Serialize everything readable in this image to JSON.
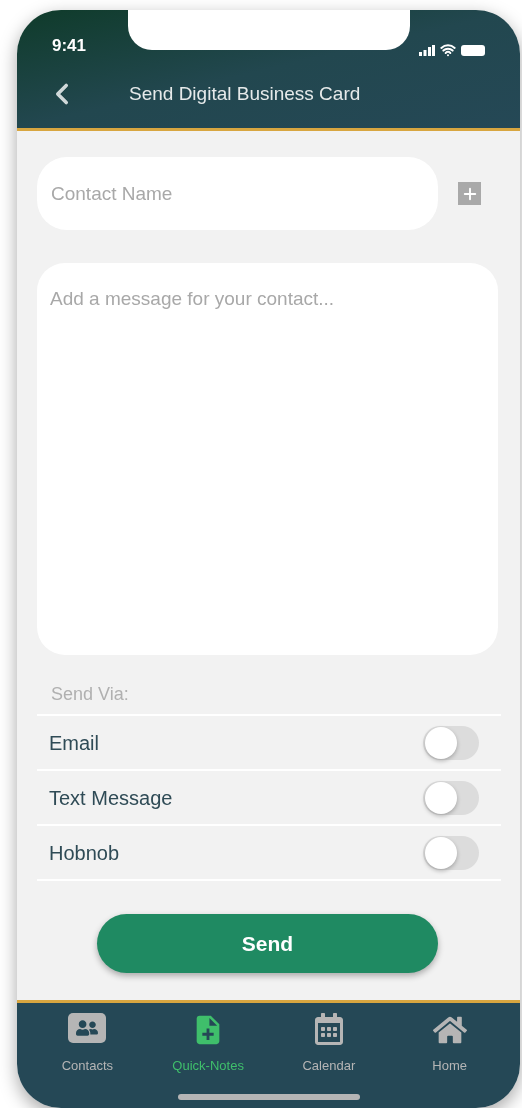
{
  "status_bar": {
    "time": "9:41"
  },
  "header": {
    "title": "Send Digital Business Card"
  },
  "contact_field": {
    "placeholder": "Contact Name"
  },
  "message_field": {
    "placeholder": "Add a message for your contact..."
  },
  "send_via": {
    "label": "Send Via:",
    "options": [
      {
        "label": "Email",
        "on": false
      },
      {
        "label": "Text Message",
        "on": false
      },
      {
        "label": "Hobnob",
        "on": false
      }
    ]
  },
  "send_button": {
    "label": "Send"
  },
  "tab_bar": [
    {
      "kind": "contacts",
      "label": "Contacts",
      "selected": false
    },
    {
      "kind": "notes",
      "label": "Quick-Notes",
      "selected": true
    },
    {
      "kind": "calendar",
      "label": "Calendar",
      "selected": false
    },
    {
      "kind": "home",
      "label": "Home",
      "selected": false
    }
  ]
}
